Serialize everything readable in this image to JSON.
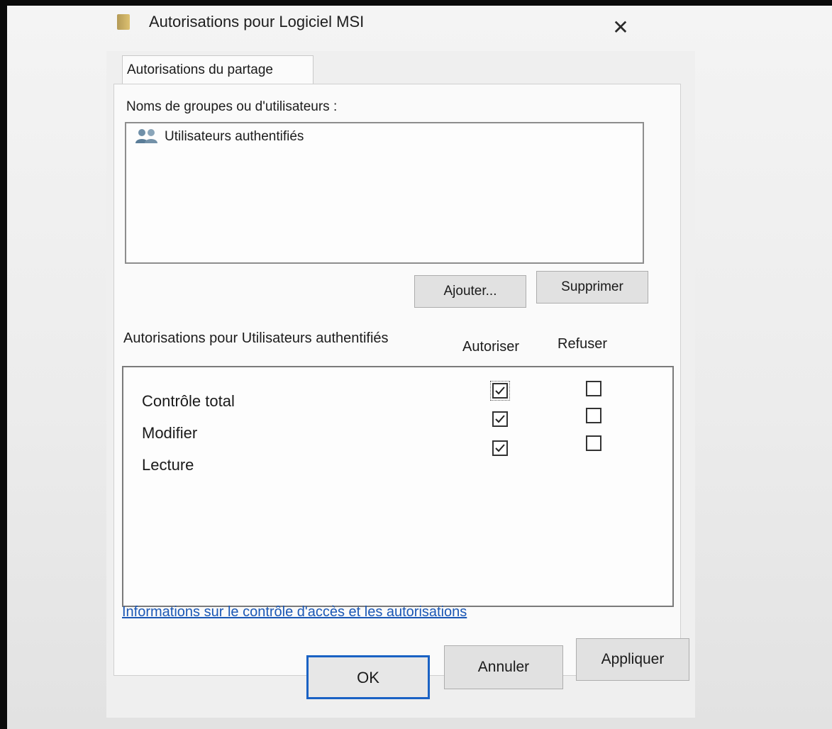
{
  "window": {
    "title": "Autorisations pour Logiciel MSI",
    "close_icon": "close-icon"
  },
  "tabs": [
    {
      "label": "Autorisations du partage",
      "selected": true
    }
  ],
  "groups": {
    "label": "Noms de groupes ou d'utilisateurs :",
    "items": [
      {
        "name": "Utilisateurs authentifiés",
        "icon": "users-group-icon"
      }
    ],
    "add_label": "Ajouter...",
    "remove_label": "Supprimer"
  },
  "permissions": {
    "title": "Autorisations pour Utilisateurs authentifiés",
    "allow_header": "Autoriser",
    "deny_header": "Refuser",
    "rows": [
      {
        "label": "Contrôle total",
        "allow": true,
        "deny": false
      },
      {
        "label": "Modifier",
        "allow": true,
        "deny": false
      },
      {
        "label": "Lecture",
        "allow": true,
        "deny": false
      }
    ]
  },
  "link_text": "Informations sur le contrôle d'accès et les autorisations",
  "buttons": {
    "ok": "OK",
    "cancel": "Annuler",
    "apply": "Appliquer"
  },
  "colors": {
    "link": "#1a57b5",
    "default_button_border": "#1a62c4"
  }
}
